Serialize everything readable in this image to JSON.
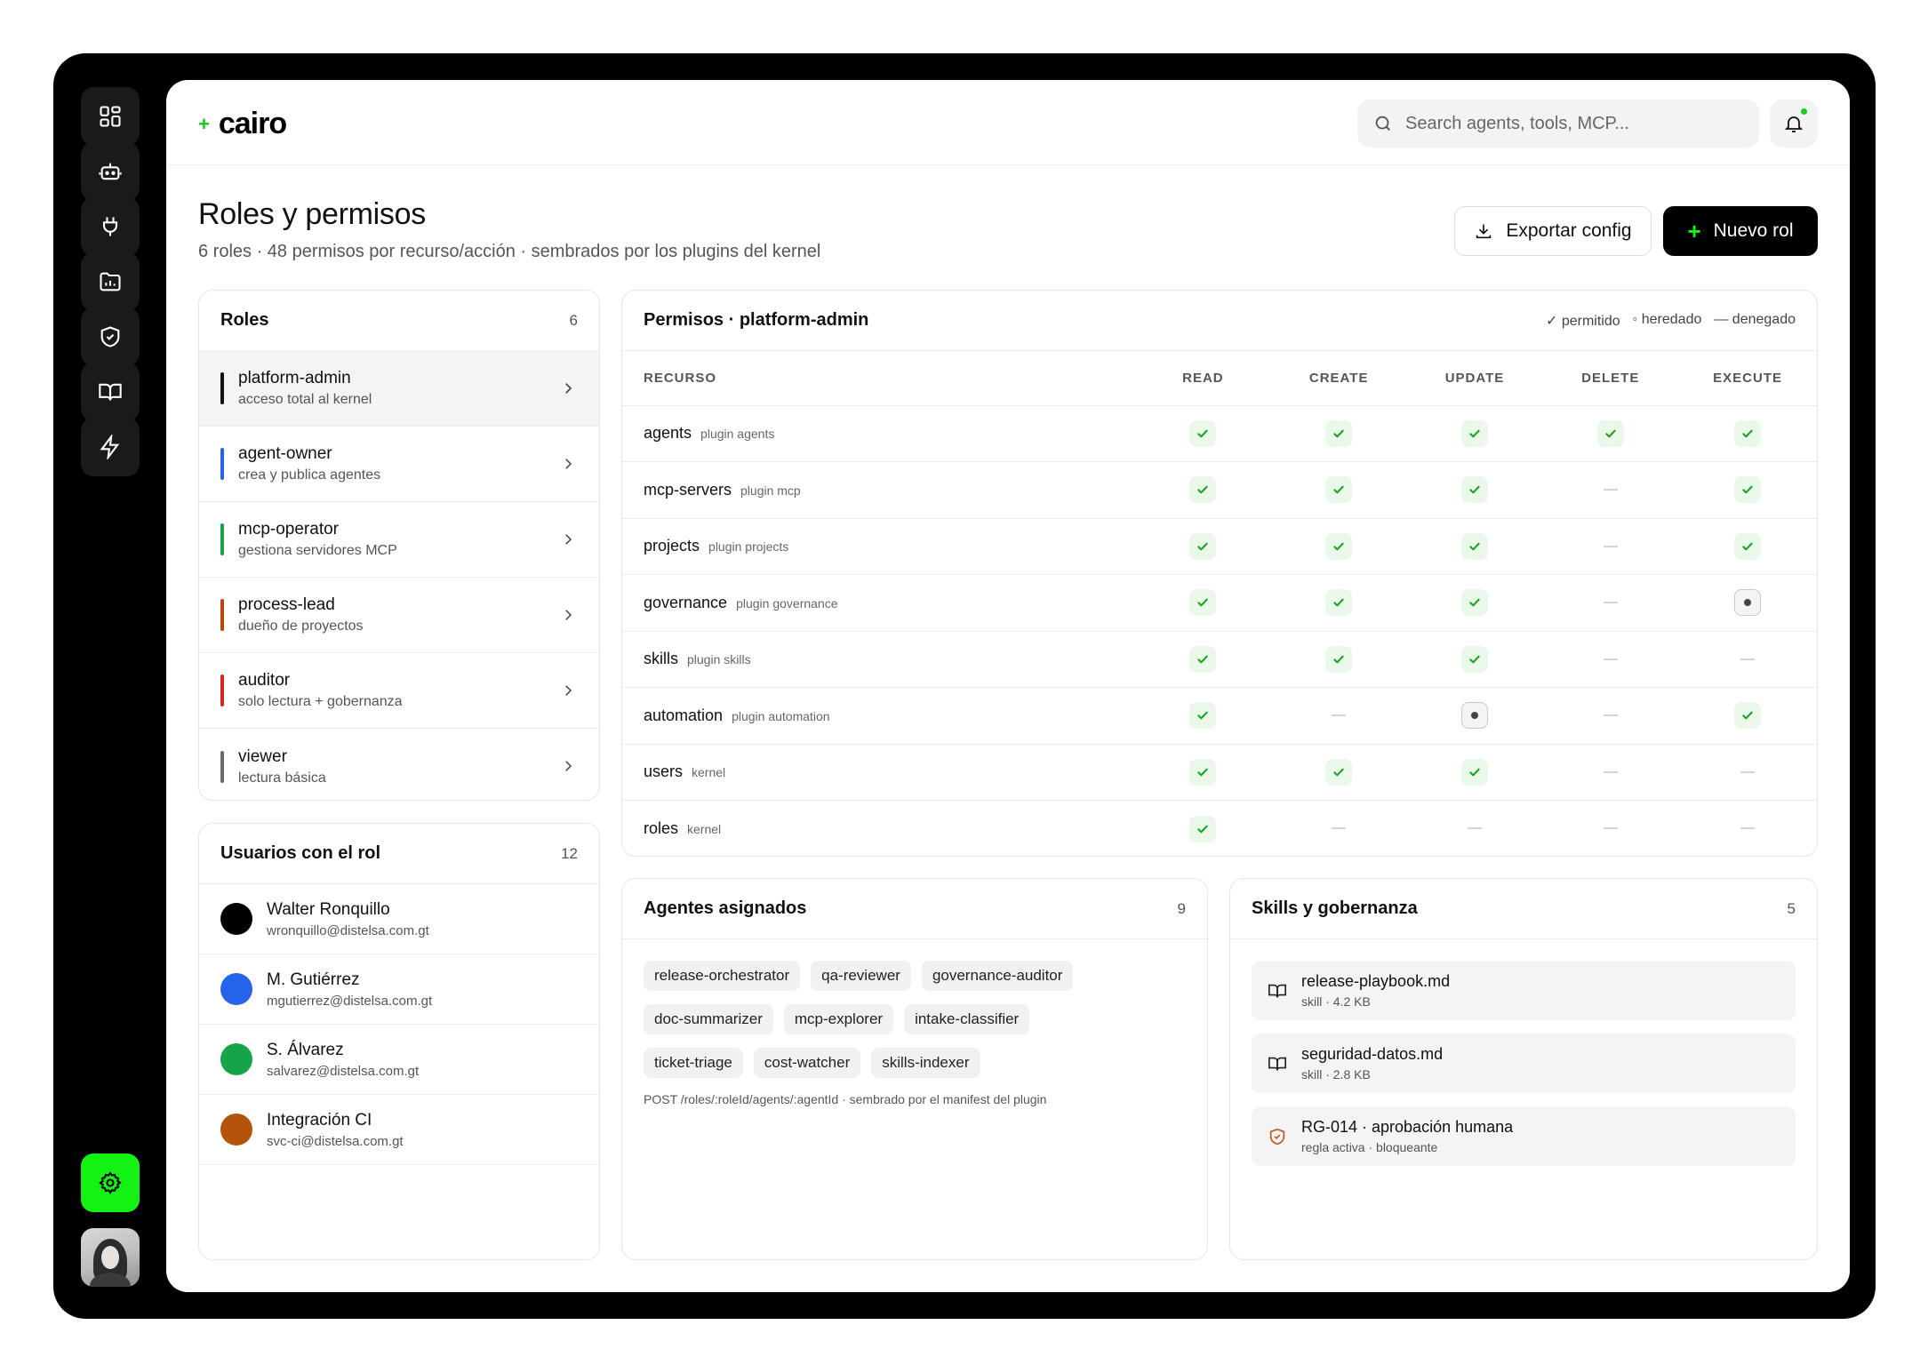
{
  "app": {
    "name": "cairo"
  },
  "search": {
    "placeholder": "Search agents, tools, MCP..."
  },
  "page": {
    "title": "Roles y permisos",
    "subtitle": "6 roles · 48 permisos por recurso/acción · sembrados por los plugins del kernel",
    "export_label": "Exportar config",
    "new_label": "Nuevo rol"
  },
  "roles": {
    "title": "Roles",
    "count": "6",
    "items": [
      {
        "name": "platform-admin",
        "desc": "acceso total al kernel",
        "color": "#111111"
      },
      {
        "name": "agent-owner",
        "desc": "crea y publica agentes",
        "color": "#2563eb"
      },
      {
        "name": "mcp-operator",
        "desc": "gestiona servidores MCP",
        "color": "#16a34a"
      },
      {
        "name": "process-lead",
        "desc": "dueño de proyectos",
        "color": "#c2410c"
      },
      {
        "name": "auditor",
        "desc": "solo lectura + gobernanza",
        "color": "#dc2626"
      },
      {
        "name": "viewer",
        "desc": "lectura básica",
        "color": "#6b6b6b"
      }
    ]
  },
  "users": {
    "title": "Usuarios con el rol",
    "count": "12",
    "items": [
      {
        "name": "Walter Ronquillo",
        "email": "wronquillo@distelsa.com.gt",
        "color": "#000000"
      },
      {
        "name": "M. Gutiérrez",
        "email": "mgutierrez@distelsa.com.gt",
        "color": "#2563eb"
      },
      {
        "name": "S. Álvarez",
        "email": "salvarez@distelsa.com.gt",
        "color": "#16a34a"
      },
      {
        "name": "Integración CI",
        "email": "svc-ci@distelsa.com.gt",
        "color": "#b45309"
      }
    ]
  },
  "permissions": {
    "title": "Permisos · platform-admin",
    "legend": {
      "allowed": "✓ permitido",
      "inherited": "◦ heredado",
      "denied": "— denegado"
    },
    "columns": [
      "RECURSO",
      "READ",
      "CREATE",
      "UPDATE",
      "DELETE",
      "EXECUTE"
    ],
    "rows": [
      {
        "resource": "agents",
        "plugin": "plugin agents",
        "cells": [
          "allowed",
          "allowed",
          "allowed",
          "allowed",
          "allowed"
        ]
      },
      {
        "resource": "mcp-servers",
        "plugin": "plugin mcp",
        "cells": [
          "allowed",
          "allowed",
          "allowed",
          "denied",
          "allowed"
        ]
      },
      {
        "resource": "projects",
        "plugin": "plugin projects",
        "cells": [
          "allowed",
          "allowed",
          "allowed",
          "denied",
          "allowed"
        ]
      },
      {
        "resource": "governance",
        "plugin": "plugin governance",
        "cells": [
          "allowed",
          "allowed",
          "allowed",
          "denied",
          "inherited"
        ]
      },
      {
        "resource": "skills",
        "plugin": "plugin skills",
        "cells": [
          "allowed",
          "allowed",
          "allowed",
          "denied",
          "denied"
        ]
      },
      {
        "resource": "automation",
        "plugin": "plugin automation",
        "cells": [
          "allowed",
          "denied",
          "inherited",
          "denied",
          "allowed"
        ]
      },
      {
        "resource": "users",
        "plugin": "kernel",
        "cells": [
          "allowed",
          "allowed",
          "allowed",
          "denied",
          "denied"
        ]
      },
      {
        "resource": "roles",
        "plugin": "kernel",
        "cells": [
          "allowed",
          "denied",
          "denied",
          "denied",
          "denied"
        ]
      }
    ]
  },
  "agents": {
    "title": "Agentes asignados",
    "count": "9",
    "chips": [
      "release-orchestrator",
      "qa-reviewer",
      "governance-auditor",
      "doc-summarizer",
      "mcp-explorer",
      "intake-classifier",
      "ticket-triage",
      "cost-watcher",
      "skills-indexer"
    ],
    "note": "POST /roles/:roleId/agents/:agentId · sembrado por el manifest del plugin"
  },
  "skills": {
    "title": "Skills y gobernanza",
    "count": "5",
    "items": [
      {
        "name": "release-playbook.md",
        "meta": "skill · 4.2 KB",
        "icon": "book-icon"
      },
      {
        "name": "seguridad-datos.md",
        "meta": "skill · 2.8 KB",
        "icon": "book-icon"
      },
      {
        "name": "RG-014 · aprobación humana",
        "meta": "regla activa · bloqueante",
        "icon": "shield-icon"
      }
    ]
  }
}
